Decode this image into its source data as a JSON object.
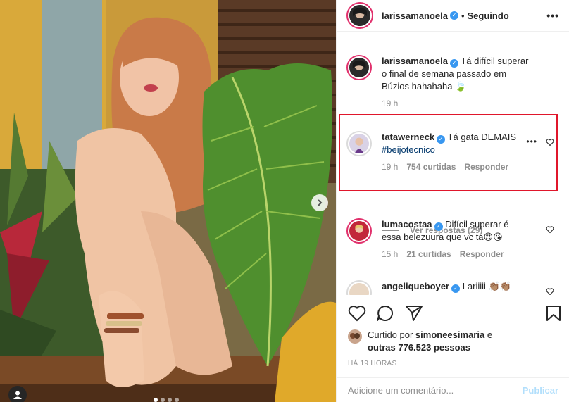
{
  "post": {
    "author": "larissamanoela",
    "follow_status": "Seguindo",
    "separator": "•"
  },
  "comments": [
    {
      "username": "larissamanoela",
      "text": "Tá difícil superar o final de semana passado em Búzios hahahaha 🍃",
      "time": "19 h"
    },
    {
      "username": "tatawerneck",
      "text": "Tá gata DEMAIS",
      "hashtag": "#beijotecnico",
      "time": "19 h",
      "likes": "754 curtidas",
      "reply": "Responder"
    },
    {
      "username": "lumacostaa",
      "text": "Difícil superar é essa belezuura que vc ta😍😘",
      "time": "15 h",
      "likes": "21 curtidas",
      "reply": "Responder"
    },
    {
      "username": "angeliqueboyer",
      "text": "Lariiiii 👏🏽👏🏽"
    }
  ],
  "view_replies": "Ver respostas (29)",
  "likes": {
    "prefix": "Curtido por ",
    "user": "simoneesimaria",
    "middle": " e",
    "others": "outras 776.523 pessoas"
  },
  "posted_ago": "HÁ 19 HORAS",
  "add_comment": {
    "placeholder": "Adicione um comentário...",
    "publish_label": "Publicar"
  },
  "carousel": {
    "slides": 4,
    "active": 0
  },
  "colors": {
    "verified": "#3897f0",
    "highlight_border": "#e0162b",
    "story_ring": "#e1306c",
    "publish_disabled": "#b2dffc"
  }
}
